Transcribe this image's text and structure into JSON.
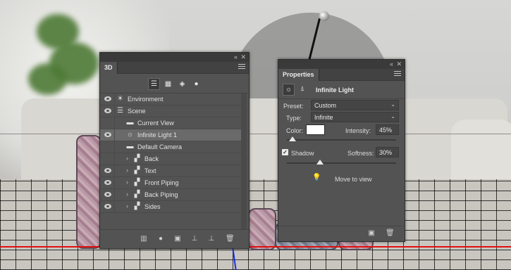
{
  "panel_3d": {
    "tab_label": "3D",
    "filters": [
      "scene-filter-icon",
      "mesh-filter-icon",
      "material-filter-icon",
      "light-filter-icon"
    ],
    "layers": [
      {
        "label": "Environment",
        "visible": true,
        "icon": "environment-icon",
        "indent": 0,
        "expandable": false,
        "selected": false
      },
      {
        "label": "Scene",
        "visible": true,
        "icon": "scene-icon",
        "indent": 0,
        "expandable": false,
        "selected": false
      },
      {
        "label": "Current View",
        "visible": false,
        "icon": "camera-icon",
        "indent": 1,
        "expandable": false,
        "selected": false
      },
      {
        "label": "Infinite Light 1",
        "visible": true,
        "icon": "infinite-light-icon",
        "indent": 1,
        "expandable": false,
        "selected": true
      },
      {
        "label": "Default Camera",
        "visible": false,
        "icon": "camera-icon",
        "indent": 1,
        "expandable": false,
        "selected": false
      },
      {
        "label": "Back",
        "visible": false,
        "icon": "mesh-icon",
        "indent": 1,
        "expandable": true,
        "selected": false
      },
      {
        "label": "Text",
        "visible": true,
        "icon": "mesh-icon",
        "indent": 1,
        "expandable": true,
        "selected": false
      },
      {
        "label": "Front Piping",
        "visible": true,
        "icon": "mesh-icon",
        "indent": 1,
        "expandable": true,
        "selected": false
      },
      {
        "label": "Back Piping",
        "visible": true,
        "icon": "mesh-icon",
        "indent": 1,
        "expandable": true,
        "selected": false
      },
      {
        "label": "Sides",
        "visible": true,
        "icon": "mesh-icon",
        "indent": 1,
        "expandable": true,
        "selected": false
      }
    ],
    "bottom_actions": [
      "new-scene-icon",
      "add-light-icon",
      "render-icon",
      "drop-to-ground-icon",
      "new-item-icon",
      "delete-icon"
    ]
  },
  "panel_props": {
    "tab_label": "Properties",
    "title": "Infinite Light",
    "preset_label": "Preset:",
    "preset_value": "Custom",
    "type_label": "Type:",
    "type_value": "Infinite",
    "color_label": "Color:",
    "color_value": "#ffffff",
    "intensity_label": "Intensity:",
    "intensity_value": "45%",
    "intensity_fraction": 0.05,
    "shadow_label": "Shadow",
    "shadow_checked": true,
    "softness_label": "Softness:",
    "softness_value": "30%",
    "softness_fraction": 0.3,
    "move_to_view_label": "Move to view",
    "bottom_actions": [
      "render-icon",
      "delete-icon"
    ]
  }
}
